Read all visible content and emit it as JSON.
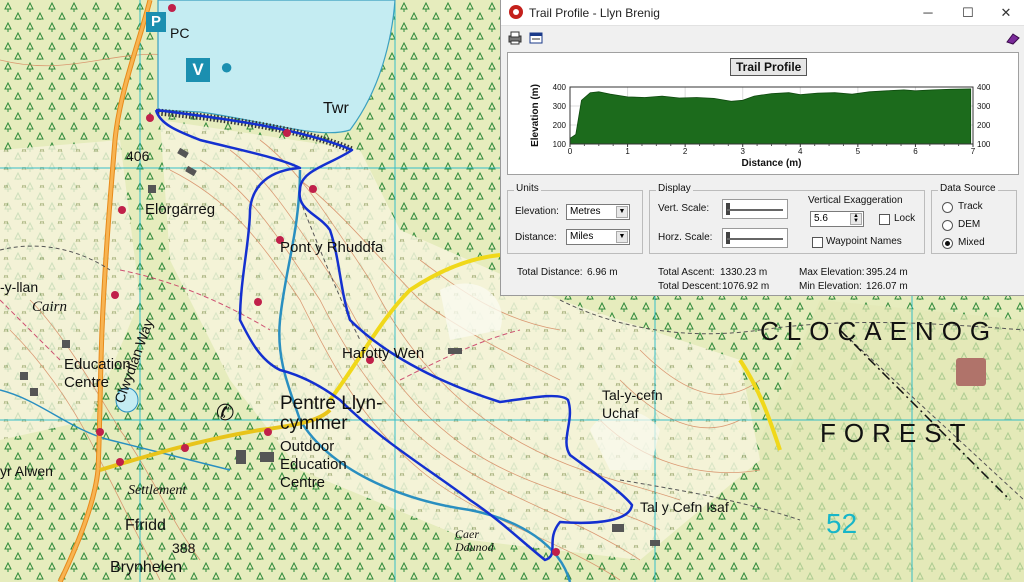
{
  "window": {
    "title": "Trail Profile - Llyn Brenig",
    "minimize": "─",
    "maximize": "☐",
    "close": "✕"
  },
  "toolbar": {
    "icons": [
      "print-icon",
      "copy-icon",
      "book-icon"
    ]
  },
  "chart_data": {
    "type": "area",
    "title": "Trail Profile",
    "xlabel": "Distance (m)",
    "ylabel": "Elevation (m)",
    "xlim": [
      0,
      7
    ],
    "ylim": [
      100,
      400
    ],
    "xticks": [
      "0",
      "1",
      "2",
      "3",
      "4",
      "5",
      "6",
      "7"
    ],
    "yticks": [
      "100",
      "200",
      "300",
      "400"
    ],
    "x": [
      0,
      0.05,
      0.1,
      0.2,
      0.35,
      0.5,
      0.7,
      1.0,
      1.3,
      1.6,
      1.9,
      2.2,
      2.5,
      2.8,
      3.0,
      3.2,
      3.5,
      3.8,
      4.0,
      4.3,
      4.6,
      4.9,
      5.2,
      5.5,
      5.8,
      6.0,
      6.3,
      6.6,
      6.96
    ],
    "y": [
      130,
      140,
      150,
      330,
      370,
      375,
      362,
      348,
      345,
      352,
      342,
      345,
      340,
      325,
      330,
      352,
      365,
      370,
      360,
      368,
      370,
      362,
      375,
      380,
      385,
      380,
      385,
      388,
      390
    ],
    "fill_color": "#1c6b1c",
    "grid": true
  },
  "units": {
    "legend": "Units",
    "elevation_label": "Elevation:",
    "elevation_value": "Metres",
    "distance_label": "Distance:",
    "distance_value": "Miles"
  },
  "display": {
    "legend": "Display",
    "vert_scale_label": "Vert. Scale:",
    "horz_scale_label": "Horz. Scale:",
    "vert_scale_value": 0.0,
    "horz_scale_value": 0.0,
    "vertical_exaggeration_label": "Vertical Exaggeration",
    "vertical_exaggeration_value": "5.6",
    "lock_label": "Lock",
    "lock_checked": false,
    "waypoint_names_label": "Waypoint Names",
    "waypoint_names_checked": false
  },
  "data_source": {
    "legend": "Data Source",
    "options": [
      "Track",
      "DEM",
      "Mixed"
    ],
    "selected": "Mixed"
  },
  "stats": {
    "total_distance_label": "Total Distance:",
    "total_distance_value": "6.96 m",
    "total_ascent_label": "Total Ascent:",
    "total_ascent_value": "1330.23 m",
    "total_descent_label": "Total Descent:",
    "total_descent_value": "1076.92 m",
    "max_elevation_label": "Max Elevation:",
    "max_elevation_value": "395.24 m",
    "min_elevation_label": "Min Elevation:",
    "min_elevation_value": "126.07 m"
  },
  "map": {
    "labels": {
      "pc": "PC",
      "parking": "P",
      "visitor_centre": "V",
      "twr": "Twr",
      "spot_406": "406",
      "elorgarreg": "Elorgarreg",
      "pont_y_rhuddfa": "Pont y Rhuddfa",
      "llan": "-y-llan",
      "cairn": "Cairn",
      "clwydian_way": "Clwydian Way",
      "education_centre_left": "Education Centre",
      "hafotty_wen": "Hafotty Wen",
      "pentre_llyn_cymmer": "Pentre Llyn-cymmer",
      "outdoor_education_centre": "Outdoor Education Centre",
      "alwen": "yr Alwen",
      "settlement": "Settlement",
      "ffridd": "Ffridd",
      "spot_388": "388",
      "brynhelen": "Brynhelen",
      "caer_ddunod": "Caer Ddunod",
      "tal_y_cefn_uchaf": "Tal-y-cefn Uchaf",
      "tal_y_cefn_isaf": "Tal y Cefn Isaf",
      "clocaenog": "CLOCAENOG",
      "forest": "FOREST",
      "grid_52": "52"
    }
  }
}
